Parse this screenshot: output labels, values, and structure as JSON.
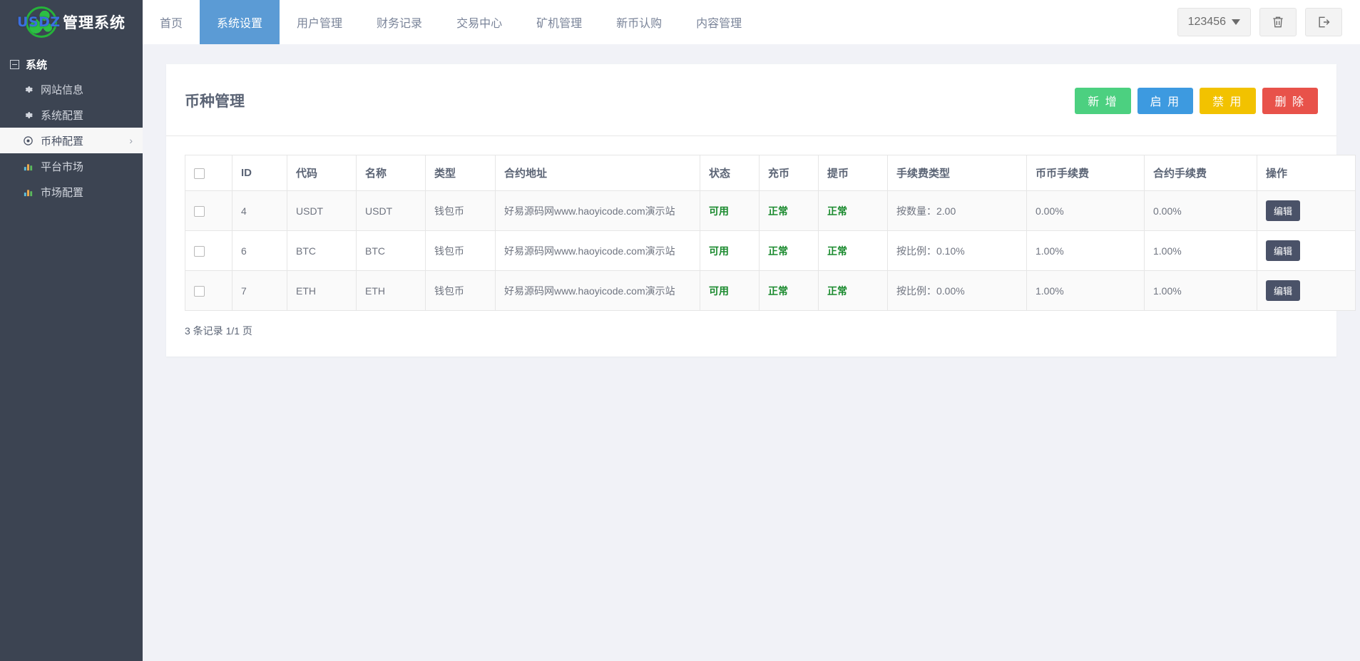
{
  "brand": {
    "logo_text": "管理系统",
    "logo_mark": "USDZ"
  },
  "topnav": {
    "items": [
      {
        "label": "首页",
        "active": false
      },
      {
        "label": "系统设置",
        "active": true
      },
      {
        "label": "用户管理",
        "active": false
      },
      {
        "label": "财务记录",
        "active": false
      },
      {
        "label": "交易中心",
        "active": false
      },
      {
        "label": "矿机管理",
        "active": false
      },
      {
        "label": "新币认购",
        "active": false
      },
      {
        "label": "内容管理",
        "active": false
      }
    ],
    "account": "123456",
    "trash_icon": "trash-icon",
    "logout_icon": "logout-icon"
  },
  "sidebar": {
    "group_label": "系统",
    "items": [
      {
        "label": "网站信息",
        "icon": "gear-icon",
        "active": false,
        "chevron": ""
      },
      {
        "label": "系统配置",
        "icon": "gear-icon",
        "active": false,
        "chevron": ""
      },
      {
        "label": "币种配置",
        "icon": "target-icon",
        "active": true,
        "chevron": "›"
      },
      {
        "label": "平台市场",
        "icon": "chart-icon",
        "active": false,
        "chevron": ""
      },
      {
        "label": "市场配置",
        "icon": "chart-icon",
        "active": false,
        "chevron": ""
      }
    ]
  },
  "page": {
    "title": "币种管理",
    "actions": [
      {
        "label": "新 增",
        "color": "#4cd080",
        "cls": "btn-green"
      },
      {
        "label": "启 用",
        "color": "#3d9ae0",
        "cls": "btn-blue"
      },
      {
        "label": "禁 用",
        "color": "#f2c200",
        "cls": "btn-yellow"
      },
      {
        "label": "删 除",
        "color": "#e8524a",
        "cls": "btn-red"
      }
    ],
    "footer_text": "3 条记录 1/1 页"
  },
  "table": {
    "columns": [
      "",
      "ID",
      "代码",
      "名称",
      "类型",
      "合约地址",
      "状态",
      "充币",
      "提币",
      "手续费类型",
      "币币手续费",
      "合约手续费",
      "操作"
    ],
    "rows": [
      {
        "id": "4",
        "code": "USDT",
        "name": "USDT",
        "type": "钱包币",
        "address": "好易源码网www.haoyicode.com演示站",
        "status": "可用",
        "deposit": "正常",
        "withdraw": "正常",
        "fee_type": "按数量：2.00",
        "spot_fee": "0.00%",
        "contract_fee": "0.00%",
        "action": "编辑"
      },
      {
        "id": "6",
        "code": "BTC",
        "name": "BTC",
        "type": "钱包币",
        "address": "好易源码网www.haoyicode.com演示站",
        "status": "可用",
        "deposit": "正常",
        "withdraw": "正常",
        "fee_type": "按比例：0.10%",
        "spot_fee": "1.00%",
        "contract_fee": "1.00%",
        "action": "编辑"
      },
      {
        "id": "7",
        "code": "ETH",
        "name": "ETH",
        "type": "钱包币",
        "address": "好易源码网www.haoyicode.com演示站",
        "status": "可用",
        "deposit": "正常",
        "withdraw": "正常",
        "fee_type": "按比例：0.00%",
        "spot_fee": "1.00%",
        "contract_fee": "1.00%",
        "action": "编辑"
      }
    ]
  },
  "colors": {
    "nav_active": "#5b9bd5",
    "sidebar_bg": "#3c4452",
    "status_green": "#1a8a2e",
    "page_bg": "#f1f2f7"
  }
}
